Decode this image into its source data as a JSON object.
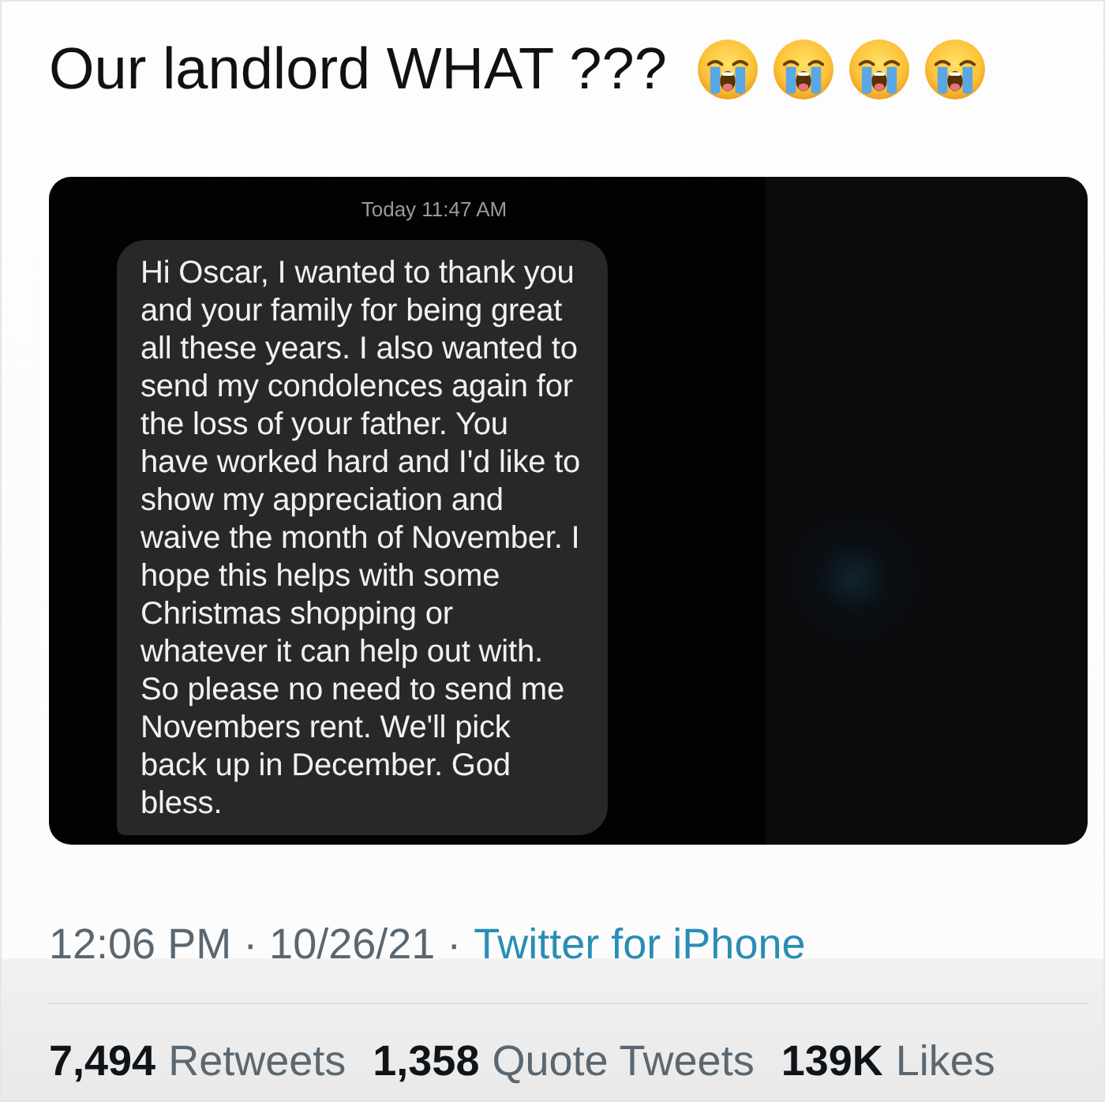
{
  "tweet": {
    "text": "Our landlord WHAT ???"
  },
  "screenshot": {
    "timestamp": "Today 11:47 AM",
    "message": {
      "lines": [
        "Hi Oscar, I wanted to thank you",
        "and your family for being great",
        "all these years. I also wanted to",
        "send my condolences again for",
        "the loss of your father. You",
        "have worked hard and I'd like to",
        "show my appreciation and",
        "waive the month of November. I",
        "hope this helps with some",
        "Christmas shopping or",
        "whatever it can help out with.",
        "So please no need to send me",
        "Novembers rent. We'll pick",
        "back up in December. God",
        "bless."
      ]
    }
  },
  "meta": {
    "posted": "12:06 PM · 10/26/21 ·",
    "source": "Twitter for iPhone"
  },
  "stats": [
    {
      "count": "7,494",
      "label": "Retweets"
    },
    {
      "count": "1,358",
      "label": "Quote Tweets"
    },
    {
      "count": "139K",
      "label": "Likes"
    }
  ]
}
